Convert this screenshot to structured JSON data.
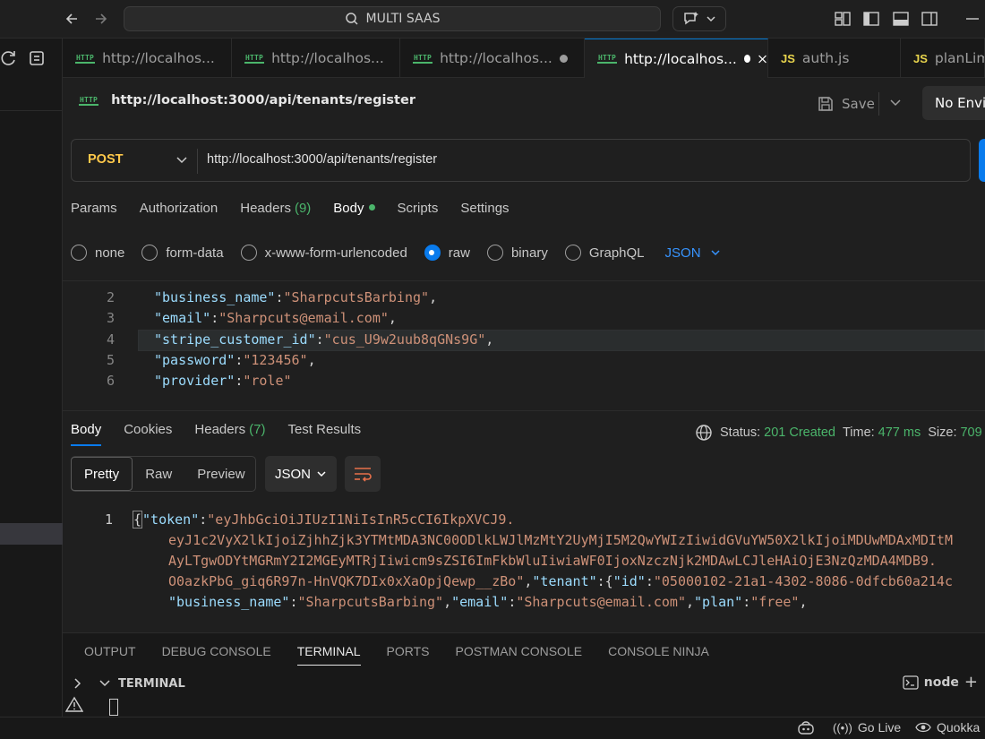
{
  "titlebar": {
    "search_text": "MULTI SAAS"
  },
  "tabs": [
    {
      "label": "http://localhos...",
      "icon": "http-icon",
      "dirty": false
    },
    {
      "label": "http://localhos...",
      "icon": "http-icon",
      "dirty": false
    },
    {
      "label": "http://localhos...",
      "icon": "http-icon",
      "dirty": true
    },
    {
      "label": "http://localhos...",
      "icon": "http-icon",
      "dirty": true,
      "active": true
    },
    {
      "label": "auth.js",
      "icon": "js-icon"
    },
    {
      "label": "planLim",
      "icon": "js-icon"
    }
  ],
  "request": {
    "title": "http://localhost:3000/api/tenants/register",
    "save_label": "Save",
    "environment": "No Envir",
    "method": "POST",
    "url": "http://localhost:3000/api/tenants/register"
  },
  "request_tabs": {
    "params": "Params",
    "authorization": "Authorization",
    "headers": "Headers",
    "headers_count": "(9)",
    "body": "Body",
    "scripts": "Scripts",
    "settings": "Settings"
  },
  "body_types": {
    "none": "none",
    "form_data": "form-data",
    "urlencoded": "x-www-form-urlencoded",
    "raw": "raw",
    "binary": "binary",
    "graphql": "GraphQL",
    "format": "JSON",
    "selected": "raw"
  },
  "editor": {
    "lines": [
      {
        "n": "2",
        "key": "\"business_name\"",
        "value": "\"SharpcutsBarbing\"",
        "trail": ","
      },
      {
        "n": "3",
        "key": "\"email\"",
        "value": "\"Sharpcuts@email.com\"",
        "trail": ","
      },
      {
        "n": "4",
        "key": "\"stripe_customer_id\"",
        "value": "\"cus_U9w2uub8qGNs9G\"",
        "trail": ","
      },
      {
        "n": "5",
        "key": "\"password\"",
        "value": "\"123456\"",
        "trail": ","
      },
      {
        "n": "6",
        "key": "\"provider\"",
        "value": "\"role\"",
        "trail": ""
      }
    ]
  },
  "response": {
    "tabs": {
      "body": "Body",
      "cookies": "Cookies",
      "headers": "Headers",
      "headers_count": "(7)",
      "tests": "Test Results"
    },
    "status_label": "Status:",
    "status_value": "201 Created",
    "time_label": "Time:",
    "time_value": "477 ms",
    "size_label": "Size:",
    "size_value": "709",
    "views": {
      "pretty": "Pretty",
      "raw": "Raw",
      "preview": "Preview"
    },
    "format": "JSON",
    "line_number": "1",
    "token_key": "\"token\"",
    "token_l1": "\"eyJhbGciOiJIUzI1NiIsInR5cCI6IkpXVCJ9.",
    "token_l2": "eyJ1c2VyX2lkIjoiZjhhZjk3YTMtMDA3NC00ODlkLWJlMzMtY2UyMjI5M2QwYWIzIiwidGVuYW50X2lkIjoiMDUwMDAxMDItM",
    "token_l3": "AyLTgwODYtMGRmY2I2MGEyMTRjIiwicm9sZSI6ImFkbWluIiwiaWF0IjoxNzczNjk2MDAwLCJleHAiOjE3NzQzMDA4MDB9.",
    "token_l4": "O0azkPbG_giq6R97n-HnVQK7DIx0xXaOpjQewp__zBo\"",
    "tenant_key": "\"tenant\"",
    "id_key": "\"id\"",
    "id_value": "\"05000102-21a1-4302-8086-0dfcb60a214c",
    "bn_key": "\"business_name\"",
    "bn_value": "\"SharpcutsBarbing\"",
    "email_key": "\"email\"",
    "email_value": "\"Sharpcuts@email.com\"",
    "plan_key": "\"plan\"",
    "plan_value": "\"free\""
  },
  "panel": {
    "tabs": [
      "OUTPUT",
      "DEBUG CONSOLE",
      "TERMINAL",
      "PORTS",
      "POSTMAN CONSOLE",
      "CONSOLE NINJA"
    ],
    "active": "TERMINAL",
    "terminal_title": "TERMINAL",
    "shell": "node"
  },
  "statusbar": {
    "go_live": "Go Live",
    "quokka": "Quokka"
  },
  "colors": {
    "accent": "#097bed",
    "method_post": "#ffc84a",
    "status_ok": "#4bb56b",
    "json_key": "#9cdcfe",
    "json_string": "#ce9178"
  }
}
